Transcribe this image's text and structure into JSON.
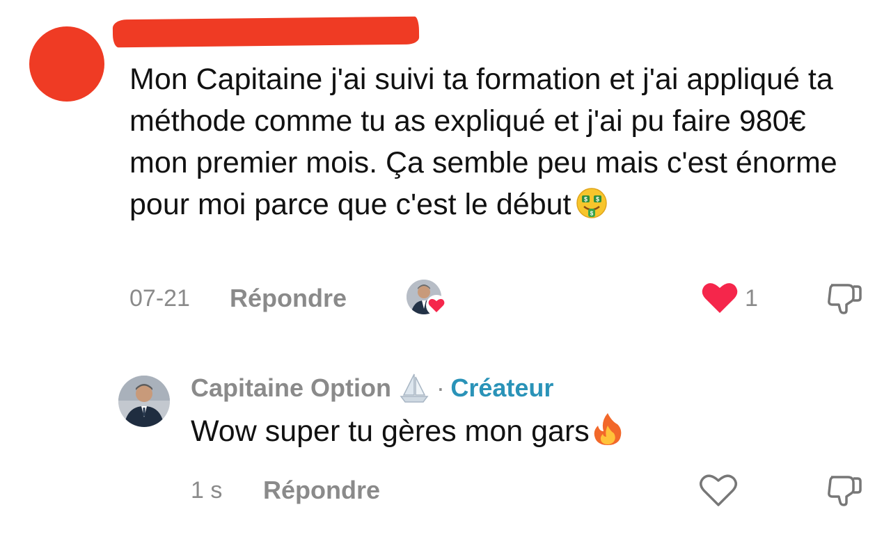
{
  "comment": {
    "text": "Mon Capitaine j'ai suivi ta formation et j'ai appliqué ta méthode comme tu as expliqué et j'ai pu faire 980€ mon premier mois. Ça semble peu mais c'est énorme pour moi parce que c'est le début",
    "trailing_emoji": "money-mouth-face-icon",
    "date": "07-21",
    "reply_label": "Répondre",
    "like_count": "1",
    "accent_red": "#ef3b24",
    "like_red": "#f5264b"
  },
  "reply": {
    "author": "Capitaine Option",
    "author_badge_icon": "sailboat-icon",
    "separator": "·",
    "role": "Créateur",
    "role_color": "#2a93b8",
    "text": "Wow super tu gères mon gars",
    "trailing_emoji": "fire-icon",
    "time": "1 s",
    "reply_label": "Répondre"
  }
}
